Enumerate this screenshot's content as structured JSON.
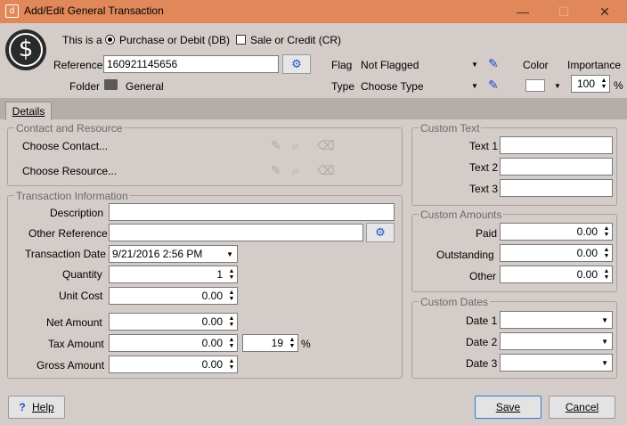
{
  "window": {
    "title": "Add/Edit General Transaction",
    "minimize": "—",
    "maximize": "☐",
    "close": "✕",
    "app_icon": "d"
  },
  "header": {
    "logo_symbol": "$",
    "this_is_a_label": "This is a",
    "option_purchase": "Purchase or Debit (DB)",
    "option_sale": "Sale or Credit (CR)",
    "reference_label": "Reference",
    "reference_value": "160921145656",
    "folder_label": "Folder",
    "folder_value": "General",
    "flag_label": "Flag",
    "flag_value": "Not Flagged",
    "type_label": "Type",
    "type_value": "Choose Type",
    "color_label": "Color",
    "importance_label": "Importance",
    "importance_value": "100",
    "importance_unit": "%"
  },
  "tabs": {
    "details": "Details"
  },
  "contact_resource": {
    "title": "Contact and Resource",
    "contact": "Choose Contact...",
    "resource": "Choose Resource..."
  },
  "transaction": {
    "title": "Transaction Information",
    "description_label": "Description",
    "description_value": "",
    "other_ref_label": "Other Reference",
    "other_ref_value": "",
    "date_label": "Transaction Date",
    "date_value": "9/21/2016 2:56 PM",
    "quantity_label": "Quantity",
    "quantity_value": "1",
    "unit_cost_label": "Unit Cost",
    "unit_cost_value": "0.00",
    "net_label": "Net Amount",
    "net_value": "0.00",
    "tax_label": "Tax Amount",
    "tax_value": "0.00",
    "tax_rate": "19",
    "tax_unit": "%",
    "gross_label": "Gross Amount",
    "gross_value": "0.00"
  },
  "custom_text": {
    "title": "Custom Text",
    "t1": "Text 1",
    "t2": "Text 2",
    "t3": "Text 3"
  },
  "custom_amounts": {
    "title": "Custom Amounts",
    "paid_label": "Paid",
    "paid_value": "0.00",
    "outstanding_label": "Outstanding",
    "outstanding_value": "0.00",
    "other_label": "Other",
    "other_value": "0.00"
  },
  "custom_dates": {
    "title": "Custom Dates",
    "d1": "Date 1",
    "d2": "Date 2",
    "d3": "Date 3"
  },
  "footer": {
    "help": "Help",
    "save": "Save",
    "cancel": "Cancel"
  },
  "colors": {
    "titlebar": "#e0885a",
    "background": "#d4ccc8",
    "tabbar": "#b4ada9",
    "accent_icon": "#1a4fcf"
  }
}
